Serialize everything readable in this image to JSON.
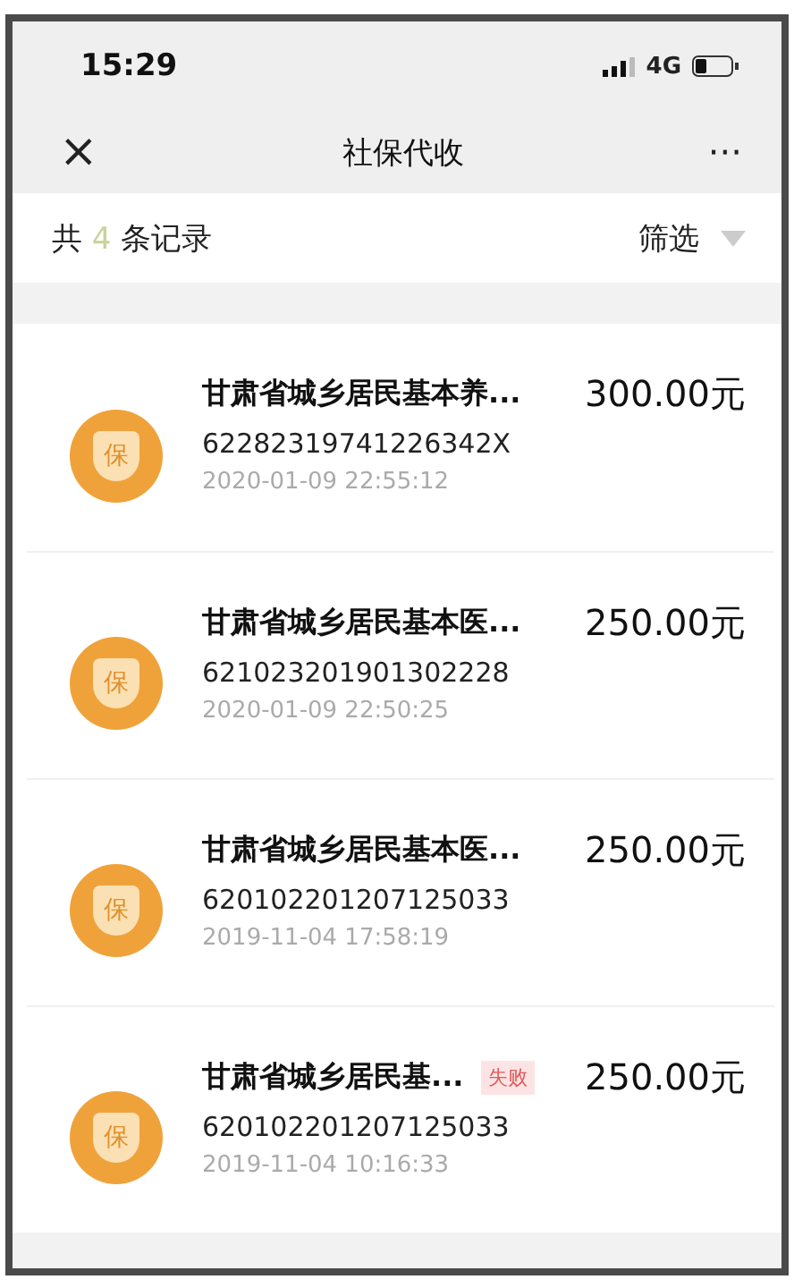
{
  "status_bar": {
    "time": "15:29",
    "network": "4G"
  },
  "nav_bar": {
    "close": "×",
    "title": "社保代收",
    "more": "···"
  },
  "summary": {
    "prefix": "共",
    "count": "4",
    "suffix": "条记录",
    "filter": "筛选"
  },
  "records": [
    {
      "icon_text": "保",
      "title": "甘肃省城乡居民基本养...",
      "id_number": "62282319741226342X",
      "time": "2020-01-09 22:55:12",
      "amount": "300.00元"
    },
    {
      "icon_text": "保",
      "title": "甘肃省城乡居民基本医...",
      "id_number": "621023201901302228",
      "time": "2020-01-09 22:50:25",
      "amount": "250.00元"
    },
    {
      "icon_text": "保",
      "title": "甘肃省城乡居民基本医...",
      "id_number": "620102201207125033",
      "time": "2019-11-04 17:58:19",
      "amount": "250.00元"
    },
    {
      "icon_text": "保",
      "title": "甘肃省城乡居民基...",
      "status": "失败",
      "id_number": "620102201207125033",
      "time": "2019-11-04 10:16:33",
      "amount": "250.00元"
    }
  ]
}
